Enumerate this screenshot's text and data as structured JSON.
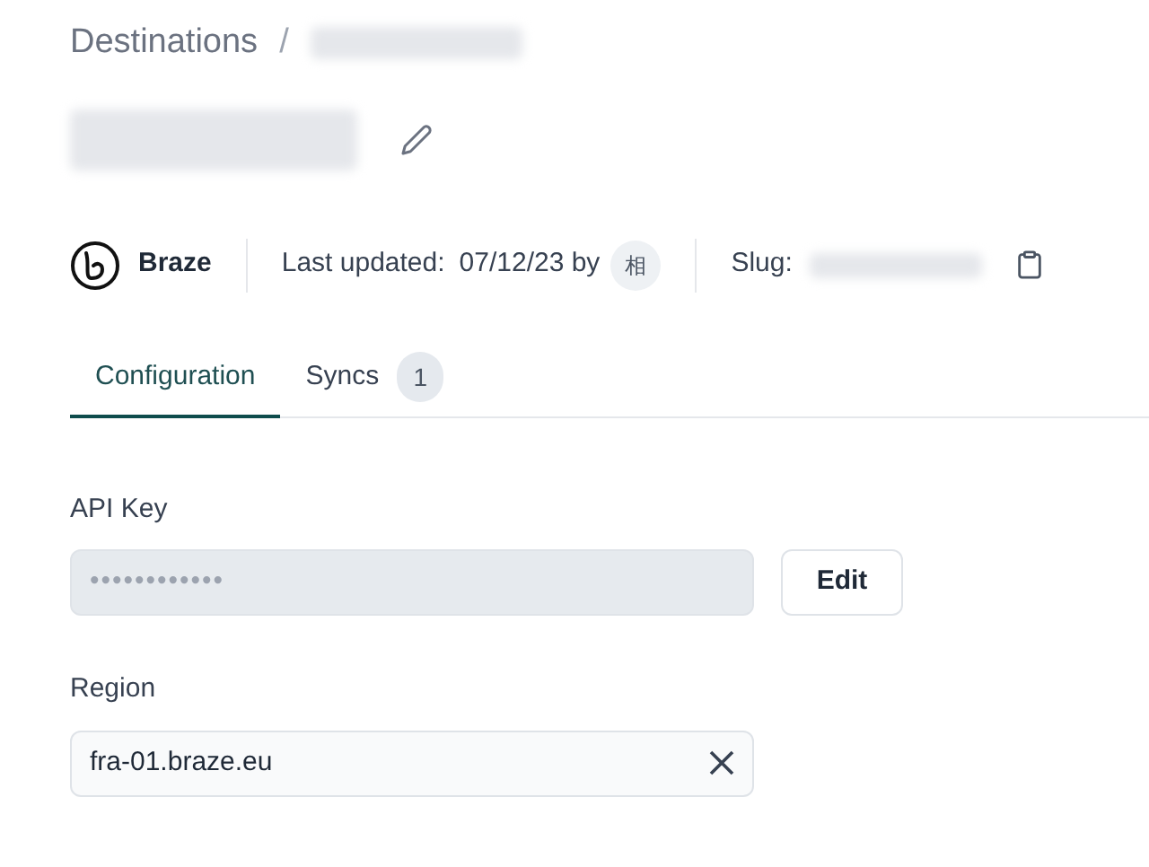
{
  "breadcrumb": {
    "items": [
      "Destinations"
    ],
    "separator": "/"
  },
  "meta": {
    "integration": "Braze",
    "updated_label": "Last updated:",
    "updated_value": "07/12/23 by",
    "avatar": "相",
    "slug_label": "Slug:"
  },
  "tabs": [
    {
      "label": "Configuration",
      "selected": true
    },
    {
      "label": "Syncs",
      "selected": false,
      "count": "1"
    }
  ],
  "fields": [
    {
      "label": "API Key",
      "value": "••••••••••••",
      "disabled": true,
      "button": "Edit"
    },
    {
      "label": "Region",
      "value": "fra-01.braze.eu",
      "disabled": false,
      "clearable": true
    }
  ]
}
